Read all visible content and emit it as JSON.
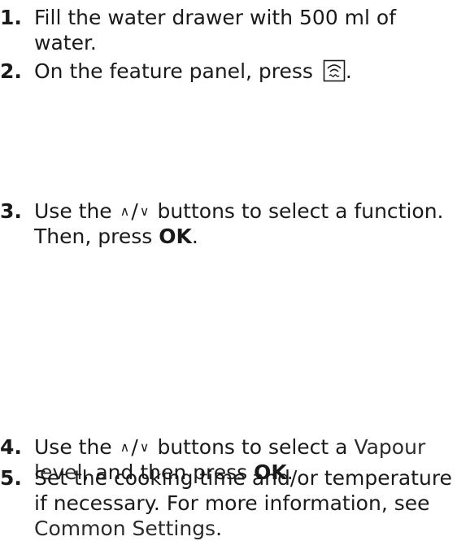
{
  "steps": [
    {
      "number": "1.",
      "text": "Fill the water drawer with 500 ml of water."
    },
    {
      "number": "2.",
      "text": "On the feature panel, press",
      "suffix": ".",
      "icon": "steam-button-icon"
    },
    {
      "number": "3.",
      "text_a": "Use the",
      "up": "∧",
      "slash": "/",
      "down": "∨",
      "text_b": "buttons to select a function. Then, press",
      "bold": "OK",
      "suffix": "."
    },
    {
      "number": "4.",
      "text_a": "Use the",
      "up": "∧",
      "slash": "/",
      "down": "∨",
      "text_b": "buttons to select a",
      "link": "Vapour level",
      "text_c": ", and then press",
      "bold": "OK",
      "suffix": "."
    },
    {
      "number": "5.",
      "text": "Set the cooking time and/or temperature if necessary. For more information, see",
      "link": "Common Settings",
      "suffix": "."
    }
  ]
}
